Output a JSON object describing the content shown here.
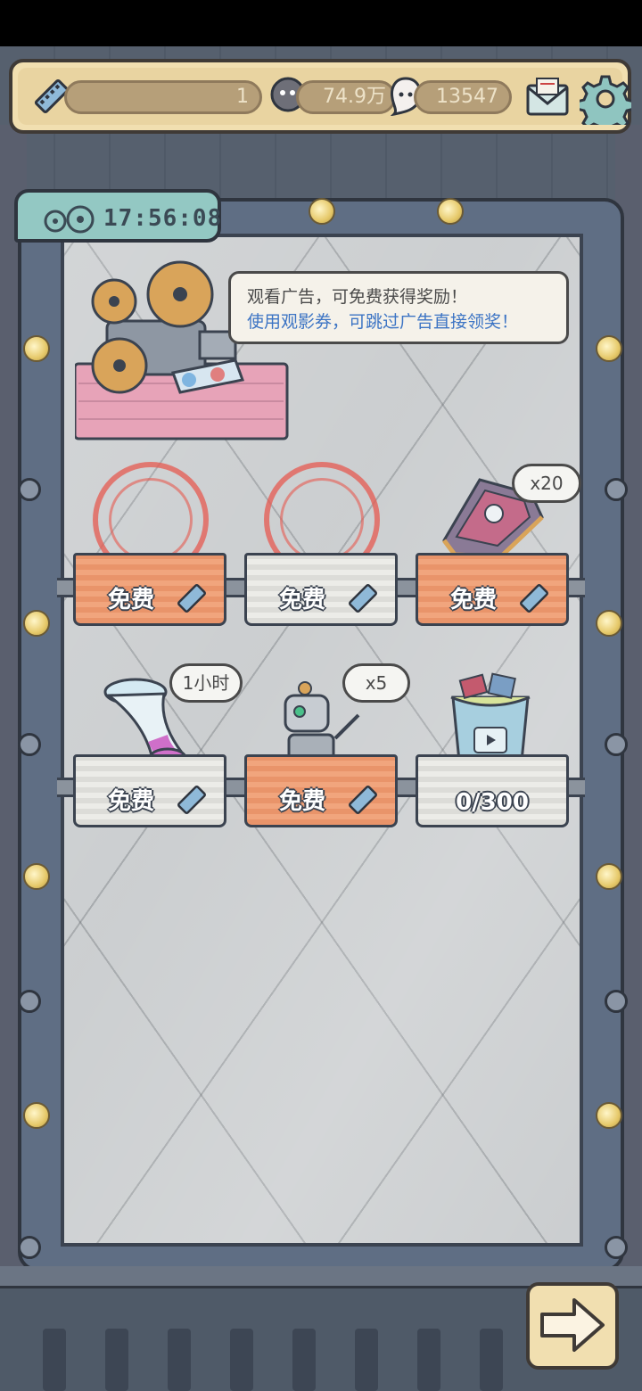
{
  "topbar": {
    "tickets": "1",
    "currency_a": "74.9万",
    "currency_b": "13547"
  },
  "timer": "17:56:08",
  "tip": {
    "line1": "观看广告，可免费获得奖励！",
    "line2": "使用观影券，可跳过广告直接领奖！"
  },
  "rewards": [
    {
      "label": "免费",
      "style": "orange",
      "claimed": true
    },
    {
      "label": "免费",
      "style": "white",
      "claimed": true
    },
    {
      "label": "免费",
      "style": "orange",
      "badge": "x20"
    },
    {
      "label": "免费",
      "style": "white",
      "badge": "1小时"
    },
    {
      "label": "免费",
      "style": "orange",
      "badge": "x5"
    },
    {
      "label": "0/300",
      "style": "white"
    }
  ],
  "colors": {
    "accent_blue": "#3c74c4",
    "cloth_orange": "#e9946a",
    "frame": "#5f6e84",
    "bar_bg": "#f1dfb0"
  },
  "icons": [
    "film-ticket-icon",
    "ghost-coin-icon",
    "soul-icon",
    "mail-icon",
    "gear-icon",
    "film-reel-icon",
    "arrow-right-icon"
  ]
}
